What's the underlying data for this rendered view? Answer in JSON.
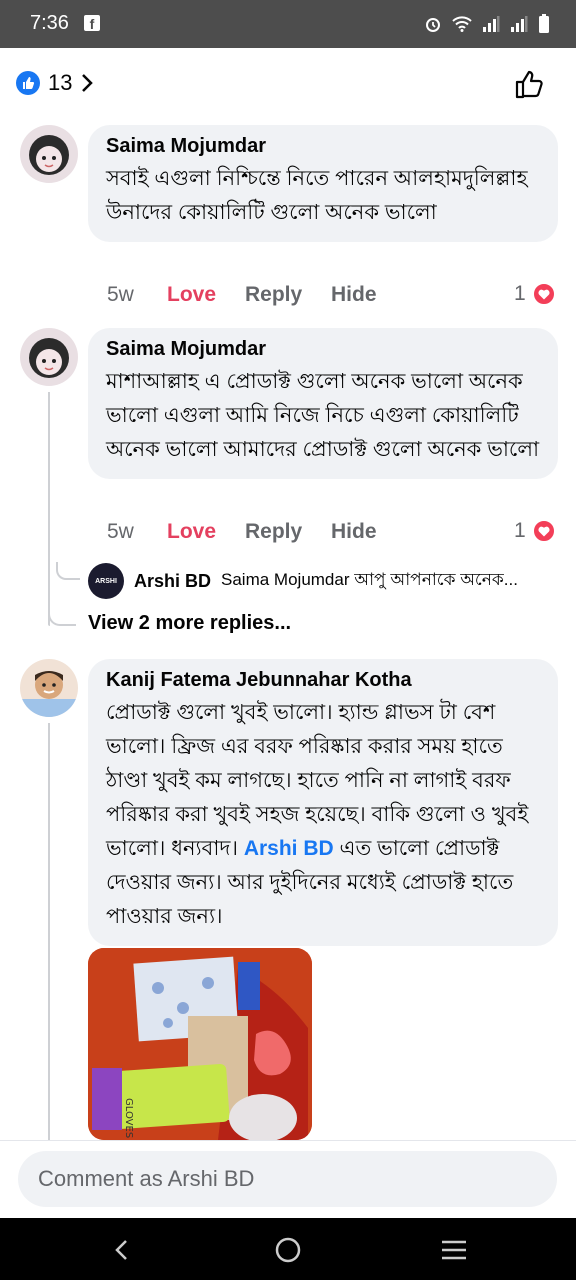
{
  "status_bar": {
    "time": "7:36",
    "app_icon": "facebook-notification-icon",
    "icons": [
      "alarm-icon",
      "wifi-icon",
      "signal-icon",
      "signal-icon",
      "battery-icon"
    ]
  },
  "header": {
    "reaction_count": "13",
    "reaction_type": "like",
    "chevron": "chevron-right-icon"
  },
  "comments": [
    {
      "author": "Saima Mojumdar",
      "text": "সবাই এগুলা নিশ্চিন্তে নিতে পারেন আলহামদুলিল্লাহ উনাদের কোয়ালিটি গুলো অনেক ভালো",
      "time": "5w",
      "love_label": "Love",
      "reply_label": "Reply",
      "hide_label": "Hide",
      "reactions": "1"
    },
    {
      "author": "Saima Mojumdar",
      "text": "মাশাআল্লাহ এ প্রোডাক্ট গুলো অনেক ভালো অনেক ভালো এগুলা আমি নিজে নিচে এগুলা কোয়ালিটি অনেক ভালো  আমাদের প্রোডাক্ট গুলো অনেক ভালো",
      "time": "5w",
      "love_label": "Love",
      "reply_label": "Reply",
      "hide_label": "Hide",
      "reactions": "1",
      "reply_preview": {
        "avatar_text": "ARSHI",
        "author": "Arshi BD",
        "snippet": "Saima Mojumdar আপু আপনাকে অনেক..."
      },
      "view_more": "View 2 more replies..."
    },
    {
      "author": "Kanij Fatema Jebunnahar Kotha",
      "text_before": "প্রোডাক্ট গুলো খুবই ভালো। হ্যান্ড গ্লাভস টা বেশ ভালো। ফ্রিজ এর বরফ পরিষ্কার করার সময় হাতে ঠাণ্ডা খুবই কম লাগছে। হাতে পানি না লাগাই বরফ পরিষ্কার করা খুবই সহজ হয়েছে। বাকি গুলো ও খুবই ভালো। ধন্যবাদ। ",
      "mention": "Arshi BD",
      "text_after": " এত ভালো প্রোডাক্ট দেওয়ার জন্য। আর দুইদিনের মধ্যেই প্রোডাক্ট হাতে পাওয়ার জন্য।",
      "photo_label": "GLOVES"
    }
  ],
  "composer": {
    "placeholder": "Comment as Arshi BD"
  },
  "nav": [
    "back-icon",
    "home-icon",
    "menu-icon"
  ],
  "colors": {
    "accent": "#1877f2",
    "love": "#e4405f",
    "bubble": "#f0f2f5",
    "status_bar": "#4d4d4d"
  }
}
